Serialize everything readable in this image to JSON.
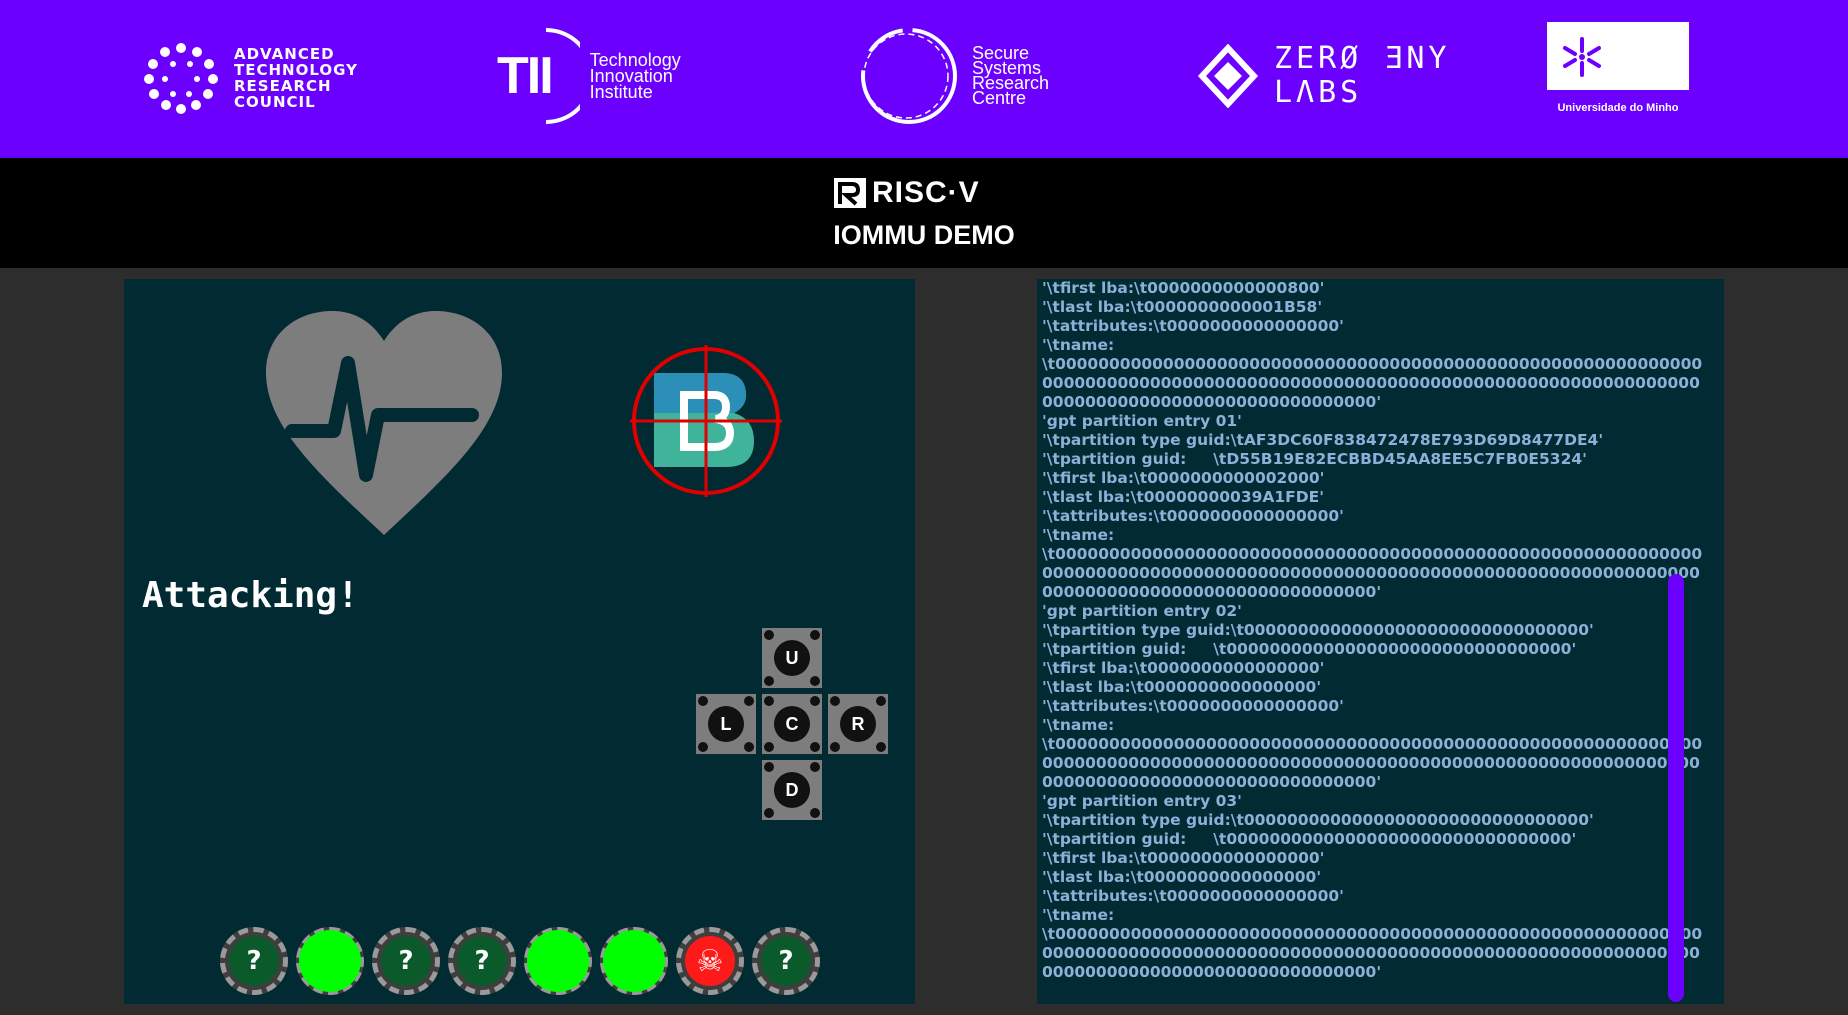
{
  "sponsors": {
    "ukri": "ADVANCED\nTECHNOLOGY\nRESEARCH\nCOUNCIL",
    "tii_mark": "TII",
    "tii": "Technology\nInnovation\nInstitute",
    "ssrc": "Secure\nSystems\nResearch\nCentre",
    "zero": "ZERØ ƎNY\nLΛBS",
    "uminho": "Universidade do Minho"
  },
  "header": {
    "riscv_logo": "RISC·V",
    "title": "IOMMU DEMO"
  },
  "game": {
    "status": "Attacking!",
    "dpad": {
      "up": "U",
      "left": "L",
      "center": "C",
      "right": "R",
      "down": "D"
    },
    "chips": [
      {
        "state": "unknown",
        "label": "?"
      },
      {
        "state": "ok",
        "label": ""
      },
      {
        "state": "unknown",
        "label": "?"
      },
      {
        "state": "unknown",
        "label": "?"
      },
      {
        "state": "ok",
        "label": ""
      },
      {
        "state": "ok",
        "label": ""
      },
      {
        "state": "alert",
        "label": "☠"
      },
      {
        "state": "unknown",
        "label": "?"
      }
    ]
  },
  "log": {
    "lines": [
      "'\\tfirst lba:\\t0000000000000800'",
      "'\\tlast lba:\\t0000000000001B58'",
      "'\\tattributes:\\t0000000000000000'",
      "'\\tname:",
      "\\t000000000000000000000000000000000000000000000000000000000000",
      "0000000000000000000000000000000000000000000000000000000000000",
      "0000000000000000000000000000000'",
      "'gpt partition entry 01'",
      "'\\tpartition type guid:\\tAF3DC60F838472478E793D69D8477DE4'",
      "'\\tpartition guid:     \\tD55B19E82ECBBD45AA8EE5C7FB0E5324'",
      "'\\tfirst lba:\\t0000000000002000'",
      "'\\tlast lba:\\t00000000039A1FDE'",
      "'\\tattributes:\\t0000000000000000'",
      "'\\tname:",
      "\\t000000000000000000000000000000000000000000000000000000000000",
      "0000000000000000000000000000000000000000000000000000000000000",
      "0000000000000000000000000000000'",
      "'gpt partition entry 02'",
      "'\\tpartition type guid:\\t00000000000000000000000000000000'",
      "'\\tpartition guid:     \\t00000000000000000000000000000000'",
      "'\\tfirst lba:\\t0000000000000000'",
      "'\\tlast lba:\\t0000000000000000'",
      "'\\tattributes:\\t0000000000000000'",
      "'\\tname:",
      "\\t000000000000000000000000000000000000000000000000000000000000",
      "0000000000000000000000000000000000000000000000000000000000000",
      "0000000000000000000000000000000'",
      "'gpt partition entry 03'",
      "'\\tpartition type guid:\\t00000000000000000000000000000000'",
      "'\\tpartition guid:     \\t00000000000000000000000000000000'",
      "'\\tfirst lba:\\t0000000000000000'",
      "'\\tlast lba:\\t0000000000000000'",
      "'\\tattributes:\\t0000000000000000'",
      "'\\tname:",
      "\\t000000000000000000000000000000000000000000000000000000000000",
      "0000000000000000000000000000000000000000000000000000000000000",
      "0000000000000000000000000000000'"
    ]
  },
  "colors": {
    "sponsor_bar": "#6c00ff",
    "panel_bg": "#022a32",
    "log_text": "#8db0d8",
    "chip_ok": "#00ff00",
    "chip_alert": "#ff1a1a",
    "chip_unknown": "#0b5a2c",
    "target_ring": "#e00000"
  },
  "icons": {
    "heart": "heart-pulse-icon",
    "target": "crosshair-target-icon",
    "monster": "b-logo-icon",
    "skull": "skull-crossbones-icon"
  }
}
